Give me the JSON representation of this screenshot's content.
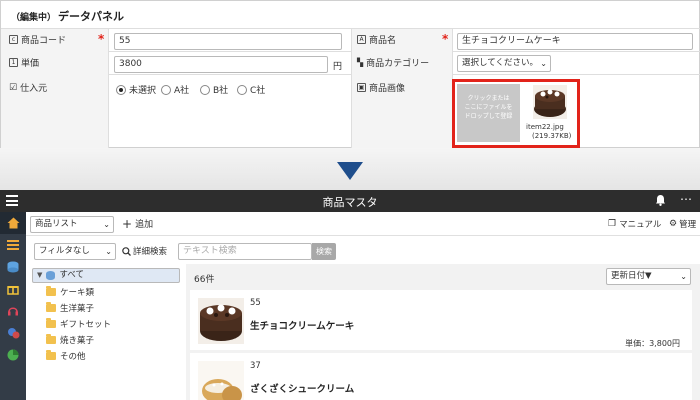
{
  "panel": {
    "title_tag": "（編集中）",
    "title": "データパネル",
    "fields": {
      "product_code_label": "商品コード",
      "product_code_value": "55",
      "product_name_label": "商品名",
      "product_name_value": "生チョコクリームケーキ",
      "unit_price_label": "単価",
      "unit_price_value": "3800",
      "unit_price_unit": "円",
      "category_label": "商品カテゴリー",
      "category_value": "選択してください。",
      "supplier_label": "仕入元",
      "supplier_options": [
        "未選択",
        "A社",
        "B社",
        "C社"
      ],
      "supplier_selected": "未選択",
      "image_label": "商品画像",
      "drop_text_1": "クリックまたは",
      "drop_text_2": "ここにファイルを",
      "drop_text_3": "ドロップして登録",
      "file_name": "item22.jpg",
      "file_size": "(219.37KB)"
    },
    "required_mark": "*"
  },
  "app": {
    "title": "商品マスタ",
    "toolbar": {
      "list_select": "商品リスト",
      "add_label": "追加",
      "manual_label": "マニュアル",
      "admin_label": "管理",
      "filter_select": "フィルタなし",
      "detail_search_label": "詳細検索",
      "text_search_placeholder": "テキスト検索",
      "search_button": "検索"
    },
    "tree": {
      "root": "すべて",
      "items": [
        "ケーキ類",
        "生洋菓子",
        "ギフトセット",
        "焼き菓子",
        "その他"
      ]
    },
    "list": {
      "count": "66件",
      "sort_select": "更新日付▼",
      "records": [
        {
          "code": "55",
          "name": "生チョコクリームケーキ",
          "price": "単価：3,800円"
        },
        {
          "code": "37",
          "name": "ざくざくシュークリーム"
        }
      ]
    }
  },
  "colors": {
    "highlight": "#e2231a",
    "arrow": "#1f4e8c",
    "titlebar": "#2d2d2d",
    "sidenav": "#333c47"
  }
}
